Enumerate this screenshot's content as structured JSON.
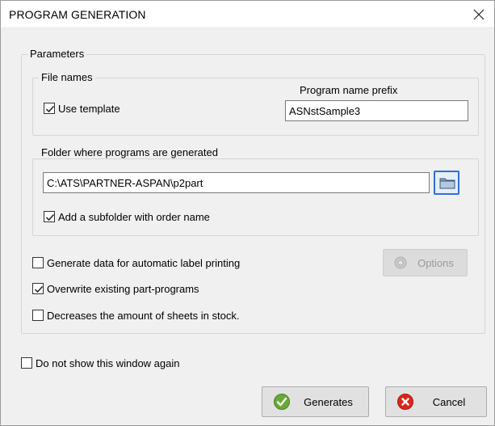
{
  "window": {
    "title": "PROGRAM GENERATION"
  },
  "parameters": {
    "group_label": "Parameters",
    "file_names": {
      "group_label": "File names",
      "use_template": {
        "label": "Use template",
        "checked": true
      },
      "prefix_label": "Program name prefix",
      "prefix_value": "ASNstSample3"
    },
    "folder": {
      "group_label": "Folder where programs are generated",
      "path": "C:\\ATS\\PARTNER-ASPAN\\p2part",
      "add_subfolder": {
        "label": "Add a subfolder with order name",
        "checked": true
      }
    },
    "label_printing": {
      "label": "Generate data for automatic label printing",
      "checked": false
    },
    "options_button": {
      "label": "Options",
      "enabled": false
    },
    "overwrite": {
      "label": "Overwrite existing part-programs",
      "checked": true
    },
    "decrease_stock": {
      "label": "Decreases the amount of sheets in stock.",
      "checked": false
    }
  },
  "dont_show_again": {
    "label": "Do not show this window again",
    "checked": false
  },
  "buttons": {
    "generate": {
      "label": "Generates",
      "icon": "green-check-icon"
    },
    "cancel": {
      "label": "Cancel",
      "icon": "red-x-icon"
    }
  },
  "colors": {
    "accent": "#2f6fd6",
    "check_green": "#6aa837",
    "cancel_red": "#d9261c"
  }
}
